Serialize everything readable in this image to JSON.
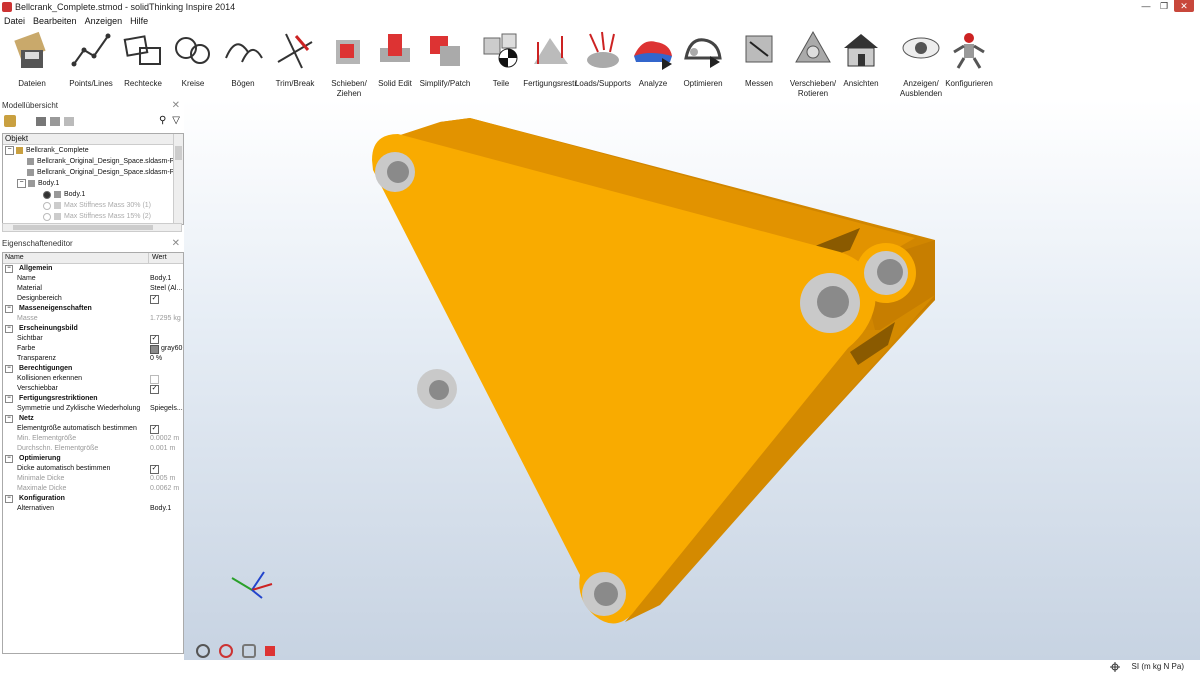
{
  "window": {
    "title": "Bellcrank_Complete.stmod - solidThinking Inspire 2014"
  },
  "menu": [
    "Datei",
    "Bearbeiten",
    "Anzeigen",
    "Hilfe"
  ],
  "toolbar": [
    {
      "label": "Dateien",
      "icon": "files-icon"
    },
    {
      "label": "Points/Lines",
      "icon": "points-lines-icon"
    },
    {
      "label": "Rechtecke",
      "icon": "rectangles-icon"
    },
    {
      "label": "Kreise",
      "icon": "circles-icon"
    },
    {
      "label": "Bögen",
      "icon": "arcs-icon"
    },
    {
      "label": "Trim/Break",
      "icon": "trim-break-icon"
    },
    {
      "label": "Schieben/\nZiehen",
      "icon": "push-pull-icon"
    },
    {
      "label": "Solid Edit",
      "icon": "solid-edit-icon"
    },
    {
      "label": "Simplify/Patch",
      "icon": "simplify-patch-icon"
    },
    {
      "label": "Teile",
      "icon": "parts-icon"
    },
    {
      "label": "Fertigungsrestr.",
      "icon": "shape-controls-icon"
    },
    {
      "label": "Loads/Supports",
      "icon": "loads-supports-icon"
    },
    {
      "label": "Analyze",
      "icon": "analyze-icon"
    },
    {
      "label": "Optimieren",
      "icon": "optimize-icon"
    },
    {
      "label": "Messen",
      "icon": "measure-icon"
    },
    {
      "label": "Verschieben/\nRotieren",
      "icon": "move-rotate-icon"
    },
    {
      "label": "Ansichten",
      "icon": "views-icon"
    },
    {
      "label": "Anzeigen/\nAusblenden",
      "icon": "show-hide-icon"
    },
    {
      "label": "Konfigurieren",
      "icon": "configure-icon"
    }
  ],
  "model_browser": {
    "title": "Modellübersicht",
    "column": "Objekt",
    "rows": [
      {
        "label": "Bellcrank_Complete"
      },
      {
        "label": "Bellcrank_Original_Design_Space.sldasm-Par"
      },
      {
        "label": "Bellcrank_Original_Design_Space.sldasm-Par"
      },
      {
        "label": "Body.1"
      },
      {
        "label": "Body.1"
      },
      {
        "label": "Max Stiffness Mass 30% (1)"
      },
      {
        "label": "Max Stiffness Mass 15% (2)"
      }
    ]
  },
  "property_editor": {
    "title": "Eigenschafteneditor",
    "col_name": "Name",
    "col_value": "Wert",
    "rows": [
      {
        "type": "cat",
        "k": "Allgemein"
      },
      {
        "k": "Name",
        "v": "Body.1"
      },
      {
        "k": "Material",
        "v": "Steel (Al..."
      },
      {
        "k": "Designbereich",
        "check": "on"
      },
      {
        "type": "cat",
        "k": "Masseneigenschaften"
      },
      {
        "k": "Masse",
        "v": "1.7295 kg",
        "gray": true
      },
      {
        "type": "cat",
        "k": "Erscheinungsbild"
      },
      {
        "k": "Sichtbar",
        "check": "on"
      },
      {
        "k": "Farbe",
        "v": "gray60",
        "swatch": "#8a8a8a"
      },
      {
        "k": "Transparenz",
        "v": "0 %"
      },
      {
        "type": "cat",
        "k": "Berechtigungen"
      },
      {
        "k": "Kollisionen erkennen",
        "check": "off"
      },
      {
        "k": "Verschiebbar",
        "check": "on"
      },
      {
        "type": "cat",
        "k": "Fertigungsrestriktionen"
      },
      {
        "k": "Symmetrie und Zyklische Wiederholung",
        "v": "Spiegels..."
      },
      {
        "type": "cat",
        "k": "Netz"
      },
      {
        "k": "Elementgröße automatisch bestimmen",
        "check": "on"
      },
      {
        "k": "Min. Elementgröße",
        "v": "0.0002 m",
        "gray": true
      },
      {
        "k": "Durchschn. Elementgröße",
        "v": "0.001 m",
        "gray": true
      },
      {
        "type": "cat",
        "k": "Optimierung"
      },
      {
        "k": "Dicke automatisch bestimmen",
        "check": "on"
      },
      {
        "k": "Minimale Dicke",
        "v": "0.005 m",
        "gray": true
      },
      {
        "k": "Maximale Dicke",
        "v": "0.0062 m",
        "gray": true
      },
      {
        "type": "cat",
        "k": "Konfiguration"
      },
      {
        "k": "Alternativen",
        "v": "Body.1"
      }
    ]
  },
  "status": {
    "units": "SI (m kg N Pa)"
  },
  "colors": {
    "part": "#f5a800",
    "part_dark": "#d08500",
    "hole": "#c8c8c8"
  }
}
